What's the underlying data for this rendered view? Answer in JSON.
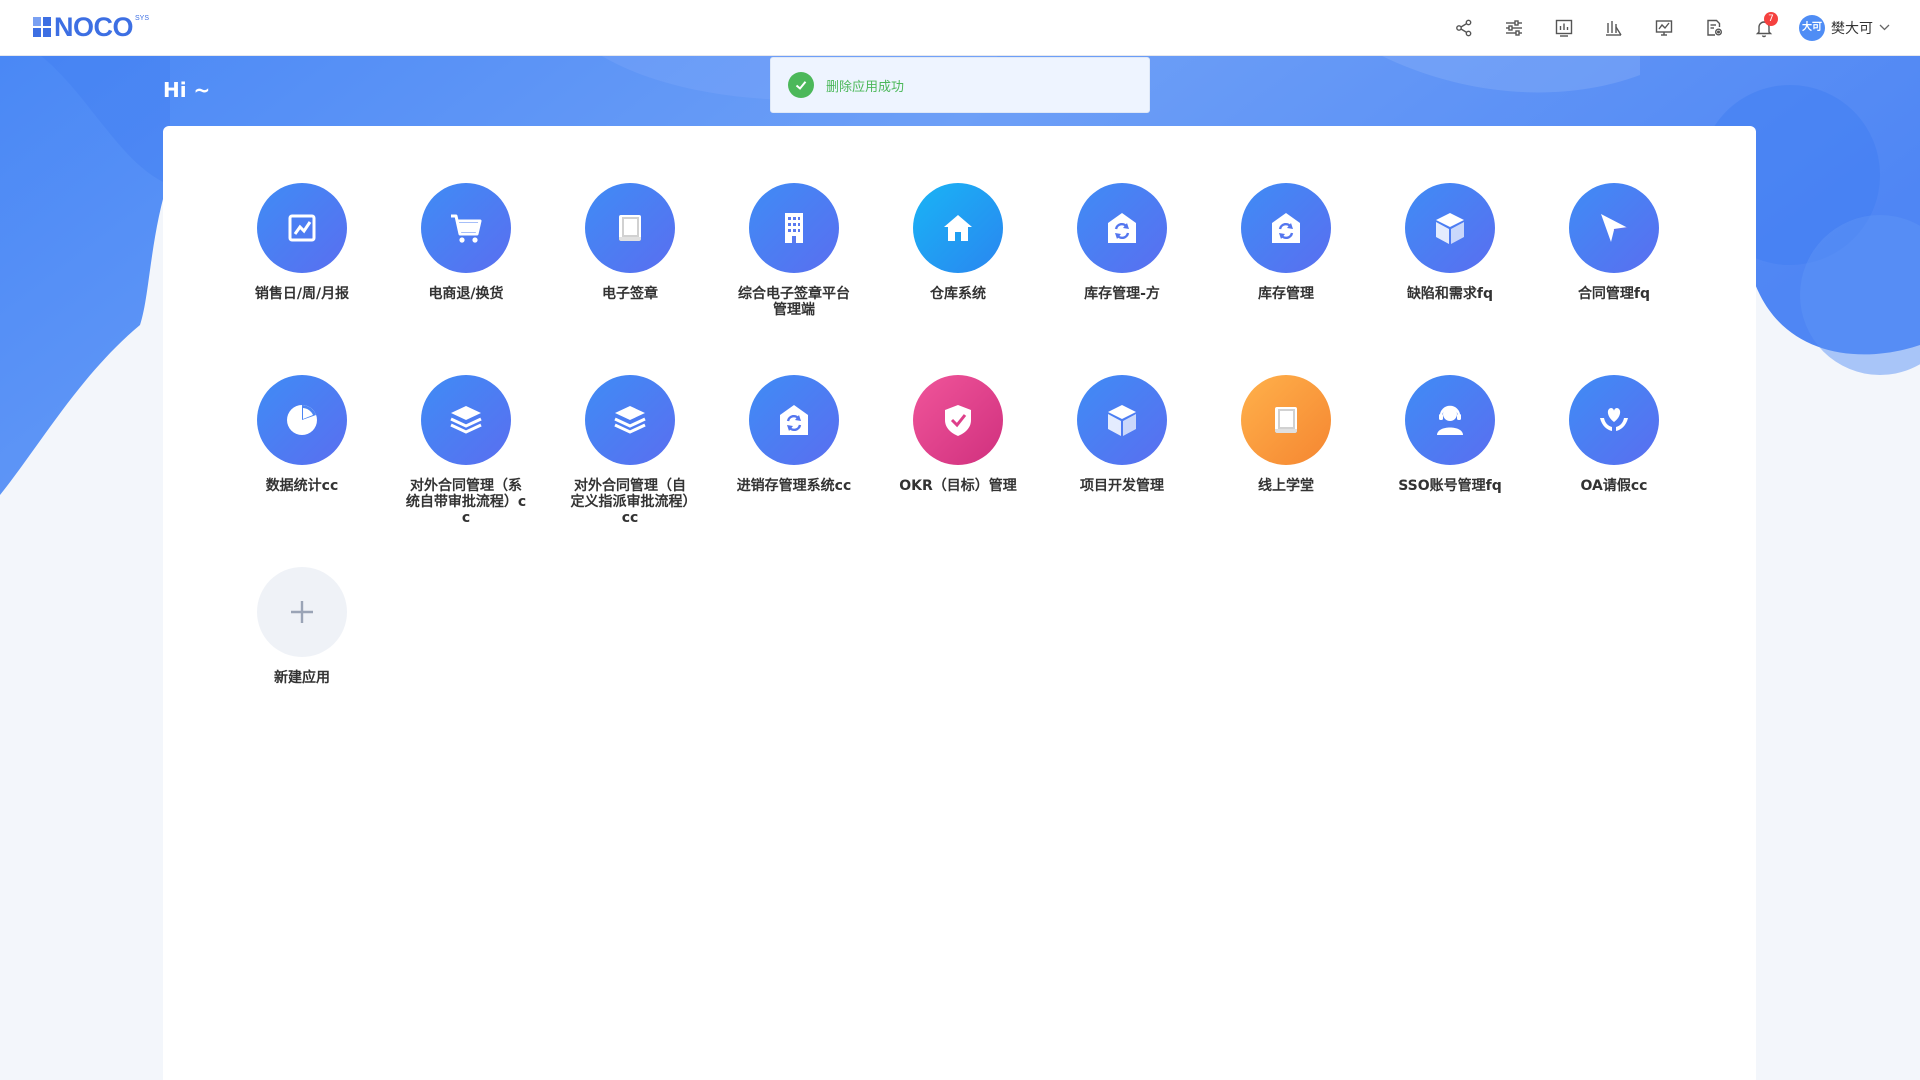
{
  "brand": {
    "logo_text": "NOCO",
    "logo_superscript": "SYS"
  },
  "header": {
    "icons": [
      "share-icon",
      "sliders-icon",
      "bar-chart-icon",
      "analytics-icon",
      "monitor-chart-icon",
      "report-settings-icon",
      "bell-icon"
    ],
    "notification_count": "7",
    "user": {
      "avatar_text": "大可",
      "name": "樊大可"
    }
  },
  "greeting": "Hi ~",
  "toast": {
    "message": "删除应用成功",
    "color": "#4cb85a"
  },
  "apps": [
    {
      "label": "销售日/周/月报",
      "icon": "line-chart-icon",
      "color": "blue"
    },
    {
      "label": "电商退/换货",
      "icon": "cart-icon",
      "color": "blue"
    },
    {
      "label": "电子签章",
      "icon": "book-icon",
      "color": "blue"
    },
    {
      "label": "综合电子签章平台管理端",
      "icon": "building-icon",
      "color": "blue"
    },
    {
      "label": "仓库系统",
      "icon": "home-icon",
      "color": "cyan"
    },
    {
      "label": "库存管理-方",
      "icon": "warehouse-sync-icon",
      "color": "blue"
    },
    {
      "label": "库存管理",
      "icon": "warehouse-sync-icon",
      "color": "blue"
    },
    {
      "label": "缺陷和需求fq",
      "icon": "cube-icon",
      "color": "blue"
    },
    {
      "label": "合同管理fq",
      "icon": "send-icon",
      "color": "blue"
    },
    {
      "label": "数据统计cc",
      "icon": "pie-chart-icon",
      "color": "blue"
    },
    {
      "label": "对外合同管理（系统自带审批流程）cc",
      "icon": "layers-icon",
      "color": "blue"
    },
    {
      "label": "对外合同管理（自定义指派审批流程）cc",
      "icon": "layers-icon",
      "color": "blue"
    },
    {
      "label": "进销存管理系统cc",
      "icon": "warehouse-sync-icon",
      "color": "blue"
    },
    {
      "label": "OKR（目标）管理",
      "icon": "shield-check-icon",
      "color": "pink"
    },
    {
      "label": "项目开发管理",
      "icon": "cube-icon",
      "color": "blue"
    },
    {
      "label": "线上学堂",
      "icon": "book-icon",
      "color": "orange"
    },
    {
      "label": "SSO账号管理fq",
      "icon": "user-support-icon",
      "color": "blue"
    },
    {
      "label": "OA请假cc",
      "icon": "heart-hands-icon",
      "color": "blue"
    }
  ],
  "add_app": {
    "label": "新建应用",
    "icon": "plus-icon"
  },
  "colors": {
    "accent": "#3d6fe3",
    "app_gradients": {
      "blue": [
        "#3f8cf5",
        "#5a6ef0"
      ],
      "cyan": [
        "#19b4f5",
        "#2a86f0"
      ],
      "pink": [
        "#f0559a",
        "#d0307e"
      ],
      "orange": [
        "#ffb14b",
        "#f58631"
      ]
    }
  }
}
